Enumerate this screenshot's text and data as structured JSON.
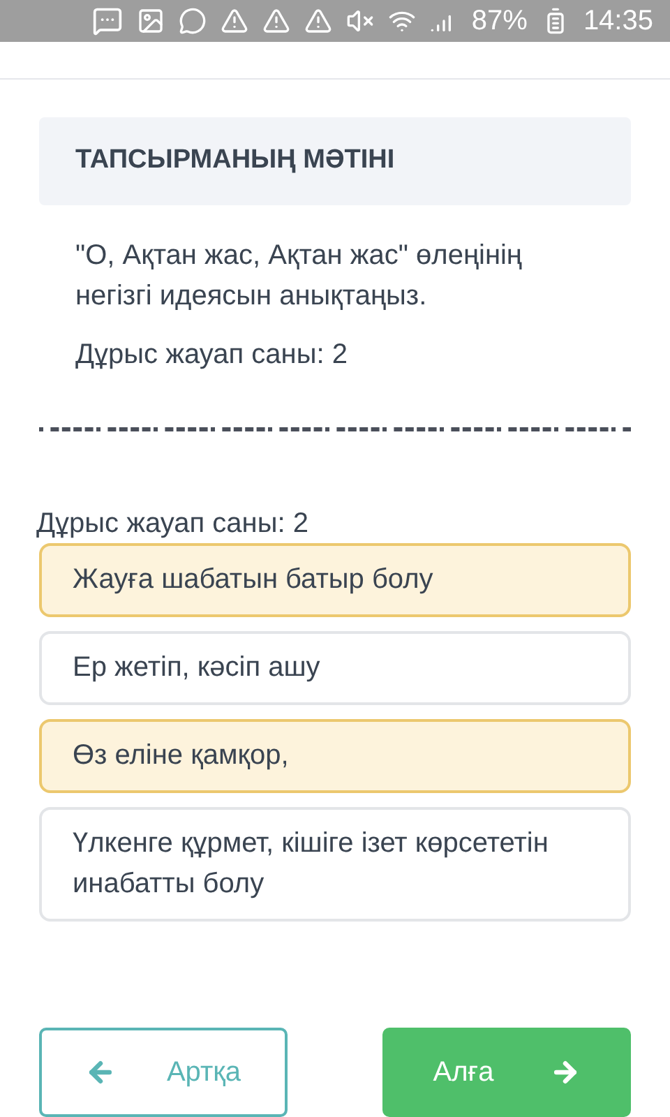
{
  "status_bar": {
    "battery": "87%",
    "time": "14:35"
  },
  "task": {
    "header": "ТАПСЫРМАНЫҢ МӘТІНІ",
    "question": "\"О, Ақтан жас, Ақтан жас\" өлеңінің негізгі идеясын анықтаңыз.",
    "answer_count": "Дұрыс жауап саны: 2"
  },
  "answer_count_label": "Дұрыс жауап саны: 2",
  "options": [
    {
      "text": "Жауға шабатын батыр болу",
      "selected": true
    },
    {
      "text": "Ер жетіп, кәсіп ашу",
      "selected": false
    },
    {
      "text": "Өз еліне қамқор,",
      "selected": true
    },
    {
      "text": "Үлкенге құрмет, кішіге ізет көрсететін инабатты болу",
      "selected": false
    }
  ],
  "buttons": {
    "back": "Артқа",
    "next": "Алға"
  }
}
